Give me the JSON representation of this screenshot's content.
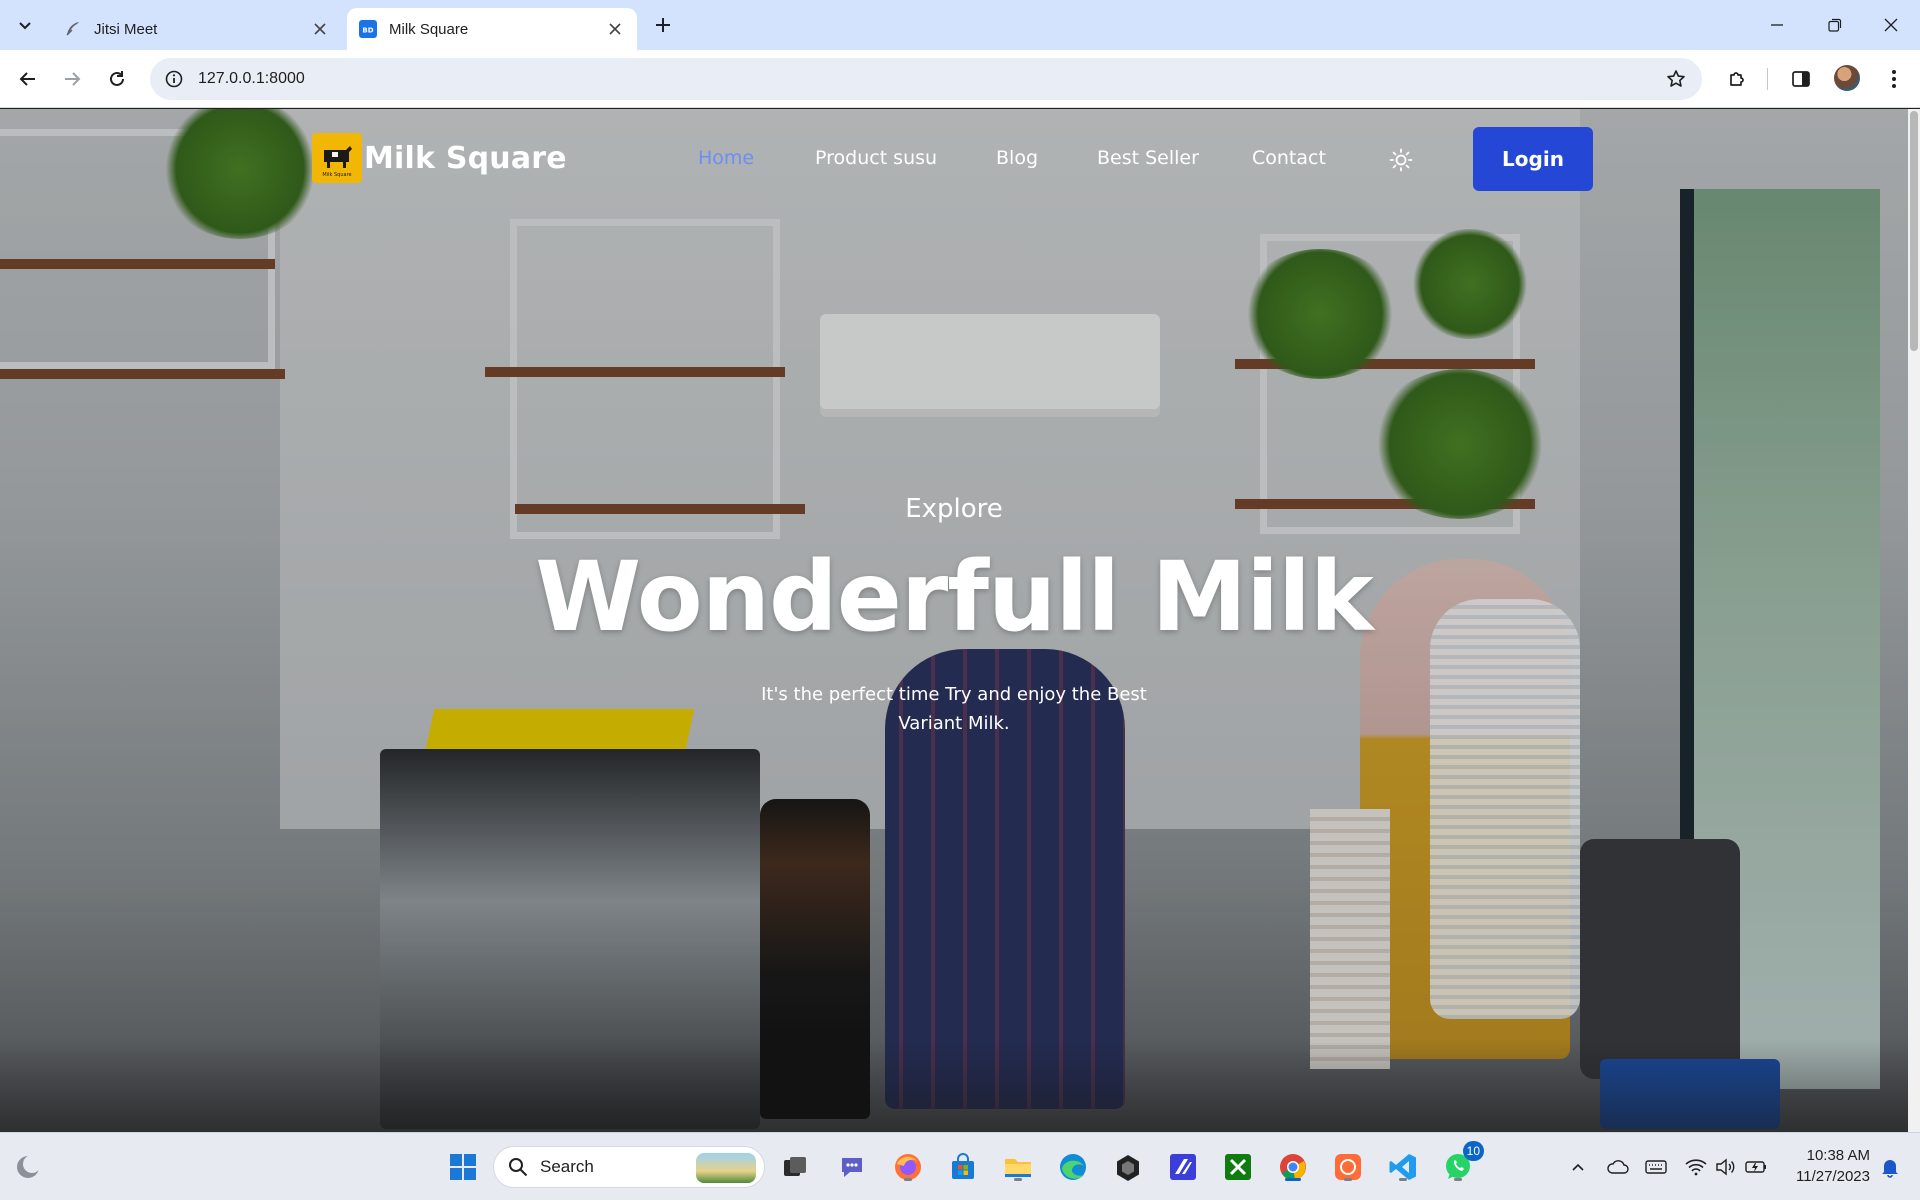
{
  "browser": {
    "tabs": [
      {
        "title": "Jitsi Meet",
        "icon": "feather-icon",
        "active": false
      },
      {
        "title": "Milk Square",
        "icon": "site-favicon",
        "active": true
      }
    ],
    "favicon_text": "BD",
    "address_bar": {
      "url": "127.0.0.1:8000"
    }
  },
  "site": {
    "brand": {
      "name": "Milk Square",
      "logo_text": "Milk Square"
    },
    "nav": [
      {
        "label": "Home",
        "active": true
      },
      {
        "label": "Product susu",
        "active": false
      },
      {
        "label": "Blog",
        "active": false
      },
      {
        "label": "Best Seller",
        "active": false
      },
      {
        "label": "Contact",
        "active": false
      }
    ],
    "login_label": "Login",
    "hero": {
      "subtitle": "Explore",
      "title": "Wonderfull Milk",
      "description": "It's the perfect time Try and enjoy the Best Variant Milk."
    },
    "colors": {
      "accent": "#2448d5",
      "active_link": "#6b8ff5",
      "logo": "#f2b705"
    }
  },
  "taskbar": {
    "search_label": "Search",
    "apps": [
      "task-view-icon",
      "teams-chat-icon",
      "firefox-icon",
      "microsoft-store-icon",
      "file-explorer-icon",
      "edge-icon",
      "unity-icon",
      "visual-studio-icon",
      "xbox-icon",
      "chrome-icon",
      "postman-icon",
      "vscode-icon",
      "whatsapp-icon"
    ],
    "whatsapp_badge": "10",
    "clock": {
      "time": "10:38 AM",
      "date": "11/27/2023"
    }
  }
}
